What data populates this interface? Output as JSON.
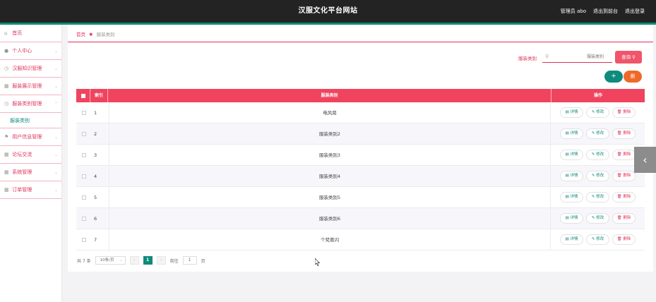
{
  "header": {
    "title": "汉服文化平台网站",
    "user_label": "管理员 abo",
    "goto_front": "退出到前台",
    "logout": "退出登录"
  },
  "sidebar": {
    "items": [
      {
        "label": "首页",
        "icon": "home-icon"
      },
      {
        "label": "个人中心",
        "icon": "user-icon"
      },
      {
        "label": "汉服知识管理",
        "icon": "clock-icon"
      },
      {
        "label": "服装展示管理",
        "icon": "grid-icon"
      },
      {
        "label": "服装类别管理",
        "icon": "clock-icon"
      },
      {
        "label": "服装类别",
        "sub": true
      },
      {
        "label": "用户信息管理",
        "icon": "flag-icon"
      },
      {
        "label": "论坛交流",
        "icon": "grid-icon"
      },
      {
        "label": "系统管理",
        "icon": "grid-icon"
      },
      {
        "label": "订单管理",
        "icon": "grid-icon"
      }
    ]
  },
  "breadcrumb": {
    "home": "首页",
    "current": "服装类别"
  },
  "search": {
    "label": "服装类别",
    "placeholder": "服装类别",
    "button": "查询"
  },
  "actions": {
    "add": "+",
    "delete": "删"
  },
  "table": {
    "headers": {
      "index": "索引",
      "name": "服装类别",
      "ops": "操作"
    },
    "op_labels": {
      "detail": "详情",
      "edit": "修改",
      "delete": "删除"
    },
    "rows": [
      {
        "index": "1",
        "name": "电风扇"
      },
      {
        "index": "2",
        "name": "服装类别2"
      },
      {
        "index": "3",
        "name": "服装类别3"
      },
      {
        "index": "4",
        "name": "服装类别4"
      },
      {
        "index": "5",
        "name": "服装类别5"
      },
      {
        "index": "6",
        "name": "服装类别6"
      },
      {
        "index": "7",
        "name": "个梵葛闪"
      }
    ]
  },
  "pagination": {
    "total": "共 7 条",
    "page_size": "10条/页",
    "current": "1",
    "goto_label": "前往",
    "goto_value": "1",
    "page_suffix": "页"
  },
  "colors": {
    "accent": "#0e8b7c",
    "primary": "#f0445e",
    "orange": "#ee6a2a"
  }
}
